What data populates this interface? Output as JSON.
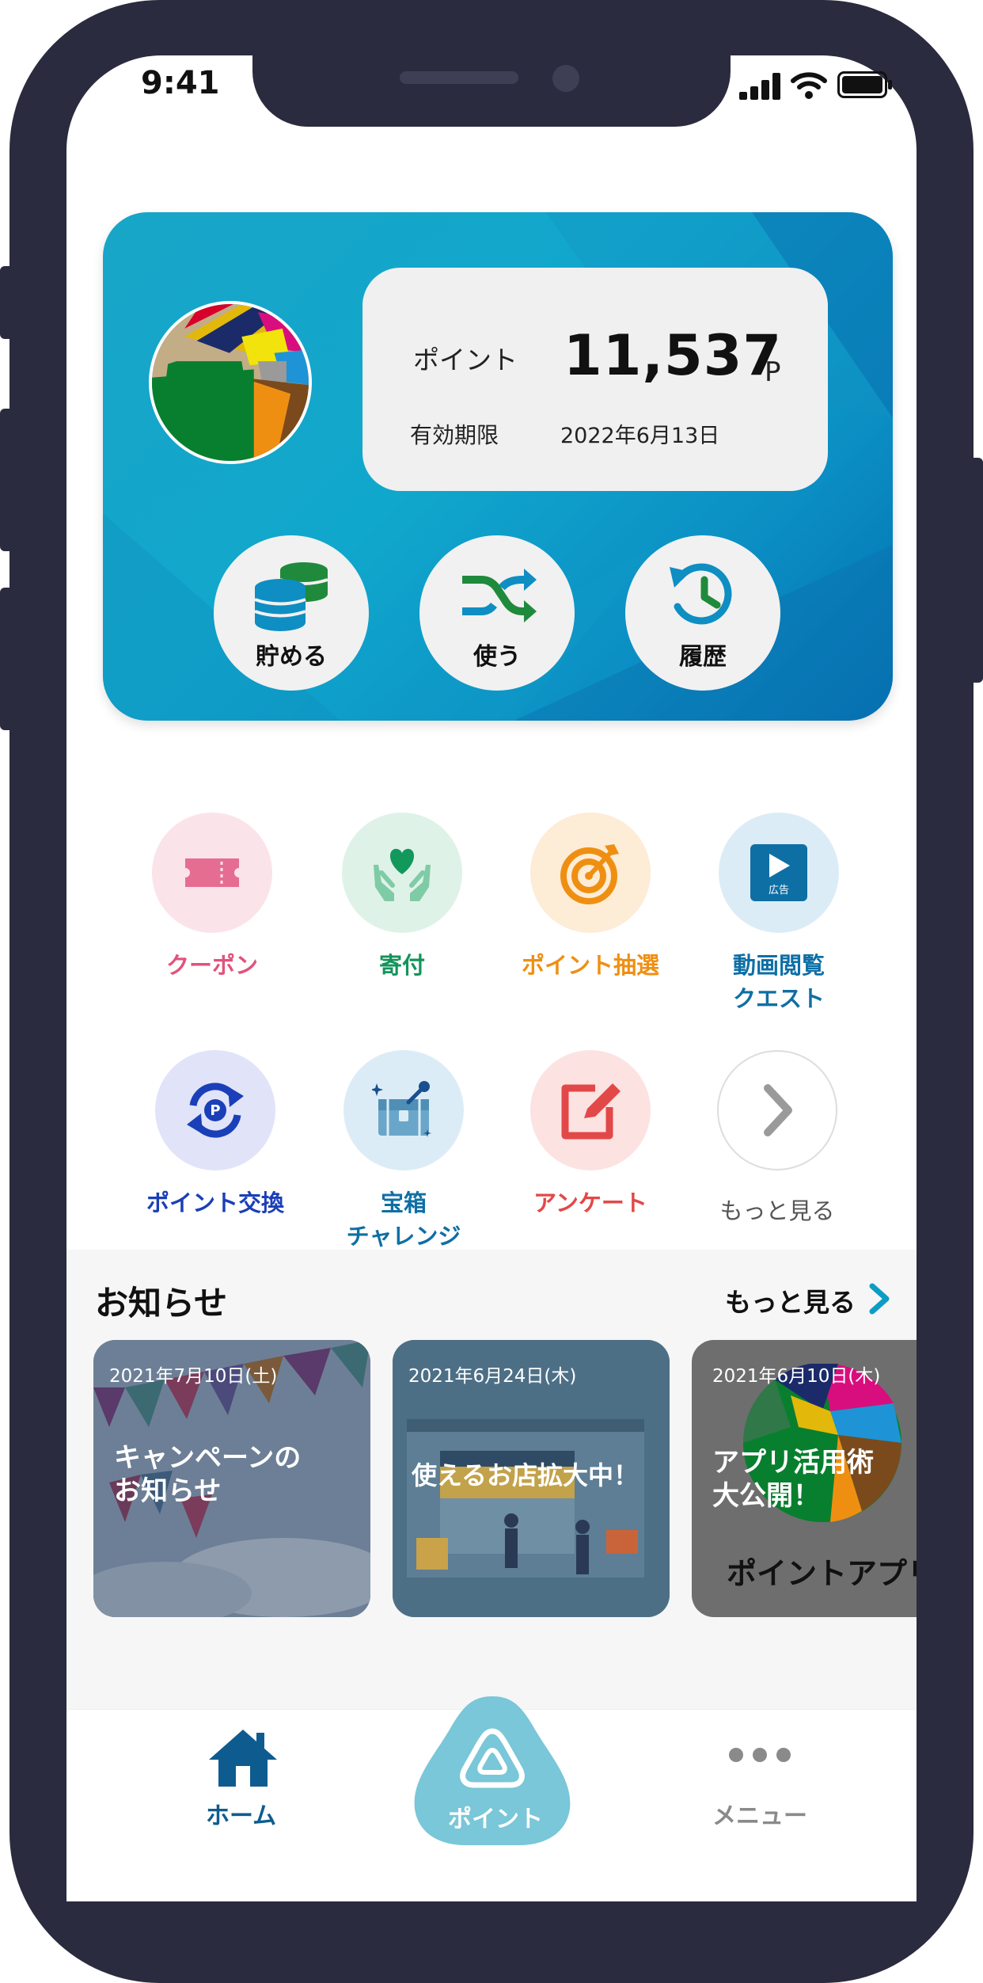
{
  "status_bar": {
    "time": "9:41"
  },
  "point_card": {
    "point_label": "ポイント",
    "point_value": "11,537",
    "point_unit": "P",
    "expiry_label": "有効期限",
    "expiry_date": "2022年6月13日",
    "actions": [
      {
        "label": "貯める",
        "icon": "coins-icon"
      },
      {
        "label": "使う",
        "icon": "shuffle-icon"
      },
      {
        "label": "履歴",
        "icon": "history-icon"
      }
    ]
  },
  "menu": [
    {
      "label": "クーポン",
      "icon": "ticket-icon",
      "color": "#e2527c"
    },
    {
      "label": "寄付",
      "icon": "heart-hands-icon",
      "color": "#12945a"
    },
    {
      "label": "ポイント抽選",
      "icon": "target-icon",
      "color": "#ef8f12"
    },
    {
      "label": "動画閲覧\nクエスト",
      "icon": "video-ad-icon",
      "color": "#0e6fa5",
      "badge": "広告"
    },
    {
      "label": "ポイント交換",
      "icon": "exchange-icon",
      "color": "#1a3fb8"
    },
    {
      "label": "宝箱\nチャレンジ",
      "icon": "treasure-chest-icon",
      "color": "#0e6fa5"
    },
    {
      "label": "アンケート",
      "icon": "survey-icon",
      "color": "#e34848"
    },
    {
      "label": "もっと見る",
      "icon": "chevron-right-icon",
      "color": "#555555"
    }
  ],
  "news": {
    "title": "お知らせ",
    "more_label": "もっと見る",
    "items": [
      {
        "date": "2021年7月10日(土)",
        "headline": "キャンペーンの\nお知らせ"
      },
      {
        "date": "2021年6月24日(木)",
        "headline": "使えるお店拡大中！"
      },
      {
        "date": "2021年6月10日(木)",
        "headline": "アプリ活用術\n大公開！",
        "sub": "ポイントアプリ"
      }
    ]
  },
  "tabbar": {
    "home": "ホーム",
    "point": "ポイント",
    "menu": "メニュー",
    "active": "home"
  },
  "colors": {
    "frame": "#2b2b3f",
    "card_gradient_start": "#19a6c8",
    "card_gradient_end": "#0470b0",
    "tab_active": "#0e6fa5",
    "tab_center": "#79c7d8"
  }
}
